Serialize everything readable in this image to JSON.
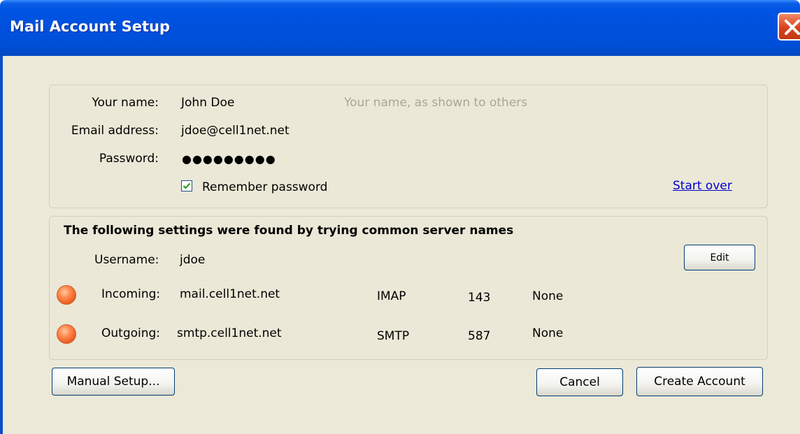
{
  "window": {
    "title": "Mail Account Setup"
  },
  "account": {
    "name_label": "Your name:",
    "name_value": "John Doe",
    "name_hint": "Your name, as shown to others",
    "email_label": "Email address:",
    "email_value": "jdoe@cell1net.net",
    "password_label": "Password:",
    "password_value": "●●●●●●●●●",
    "remember_label": "Remember password",
    "remember_checked": true,
    "start_over": "Start over"
  },
  "settings": {
    "heading": "The following settings were found by trying common server names",
    "username_label": "Username:",
    "username_value": "jdoe",
    "edit_button": "Edit",
    "incoming": {
      "label": "Incoming:",
      "server": "mail.cell1net.net",
      "protocol": "IMAP",
      "port": "143",
      "security": "None",
      "status_color": "#f07a3c"
    },
    "outgoing": {
      "label": "Outgoing:",
      "server": "smtp.cell1net.net",
      "protocol": "SMTP",
      "port": "587",
      "security": "None",
      "status_color": "#f07a3c"
    }
  },
  "buttons": {
    "manual_setup": "Manual Setup...",
    "cancel": "Cancel",
    "create_account": "Create Account"
  },
  "colors": {
    "titlebar": "#0054e3",
    "dialog_bg": "#ece9d8",
    "link": "#0000cc"
  }
}
